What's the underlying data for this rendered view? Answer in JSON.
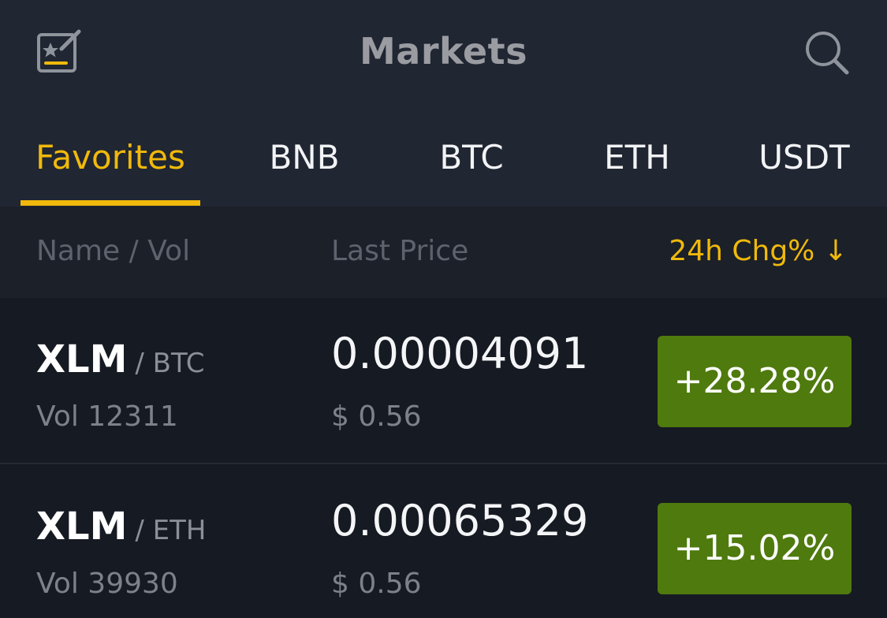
{
  "header": {
    "title": "Markets",
    "left_icon": "edit-favorites-icon",
    "right_icon": "search-icon"
  },
  "tabs": [
    {
      "label": "Favorites",
      "active": true
    },
    {
      "label": "BNB",
      "active": false
    },
    {
      "label": "BTC",
      "active": false
    },
    {
      "label": "ETH",
      "active": false
    },
    {
      "label": "USDT",
      "active": false
    }
  ],
  "columns": {
    "name_vol": "Name / Vol",
    "last_price": "Last Price",
    "change": "24h Chg% ↓"
  },
  "rows": [
    {
      "base": "XLM",
      "quote": "BTC",
      "volume": "Vol 12311",
      "price": "0.00004091",
      "usd_price": "$ 0.56",
      "change": "+28.28%"
    },
    {
      "base": "XLM",
      "quote": "ETH",
      "volume": "Vol 39930",
      "price": "0.00065329",
      "usd_price": "$ 0.56",
      "change": "+15.02%"
    }
  ],
  "colors": {
    "accent": "#f0b90b",
    "positive_badge": "#4f7a0e",
    "header_bg": "#202632",
    "list_bg": "#161a22"
  }
}
